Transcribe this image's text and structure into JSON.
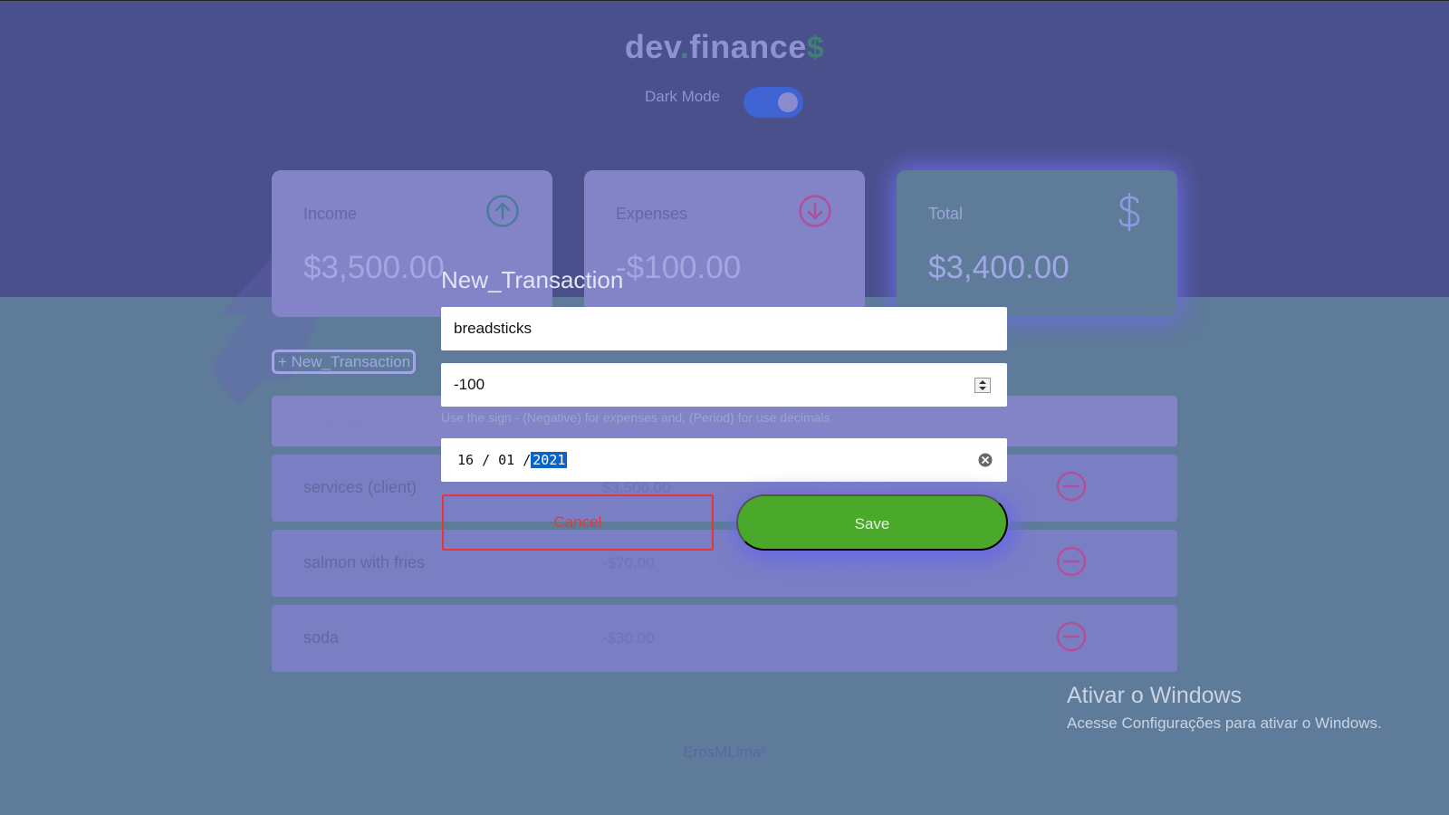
{
  "header": {
    "logo": {
      "prefix": "dev",
      "dot": ".",
      "name": "finance",
      "suffix": "$"
    },
    "dark_mode_label": "Dark Mode",
    "dark_mode_on": true
  },
  "cards": [
    {
      "label": "Income",
      "value": "$3,500.00",
      "icon": "arrow-up-circle-icon"
    },
    {
      "label": "Expenses",
      "value": "-$100.00",
      "icon": "arrow-down-circle-icon"
    },
    {
      "label": "Total",
      "value": "$3,400.00",
      "icon": "dollar-icon"
    }
  ],
  "new_transaction_button": "+ New_Transaction",
  "table": {
    "headers": [
      "Description"
    ],
    "rows": [
      {
        "description": "services (client)",
        "amount": "$3,500.00",
        "date": "16/02/2021"
      },
      {
        "description": "salmon with fries",
        "amount": "-$70.00",
        "date": "16/02/2021"
      },
      {
        "description": "soda",
        "amount": "-$30.00",
        "date": "16/02/2021"
      }
    ]
  },
  "modal": {
    "title": "New_Transaction",
    "description_value": "breadsticks",
    "amount_value": "-100",
    "hint": "Use the sign - (Negative) for expenses and, (Period) for use decimals",
    "date": {
      "day": "16",
      "month": "01",
      "year": "2021"
    },
    "cancel_label": "Cancel",
    "save_label": "Save"
  },
  "footer": "ErosMLima²",
  "watermark": {
    "title": "Ativar o Windows",
    "subtitle": "Acesse Configurações para ativar o Windows."
  },
  "colors": {
    "header_bg": "#4a508c",
    "overlay_bg": "#5e7b99",
    "save_green": "#4aa82a",
    "cancel_red": "#e43838",
    "toggle_blue": "#3f63d2"
  }
}
